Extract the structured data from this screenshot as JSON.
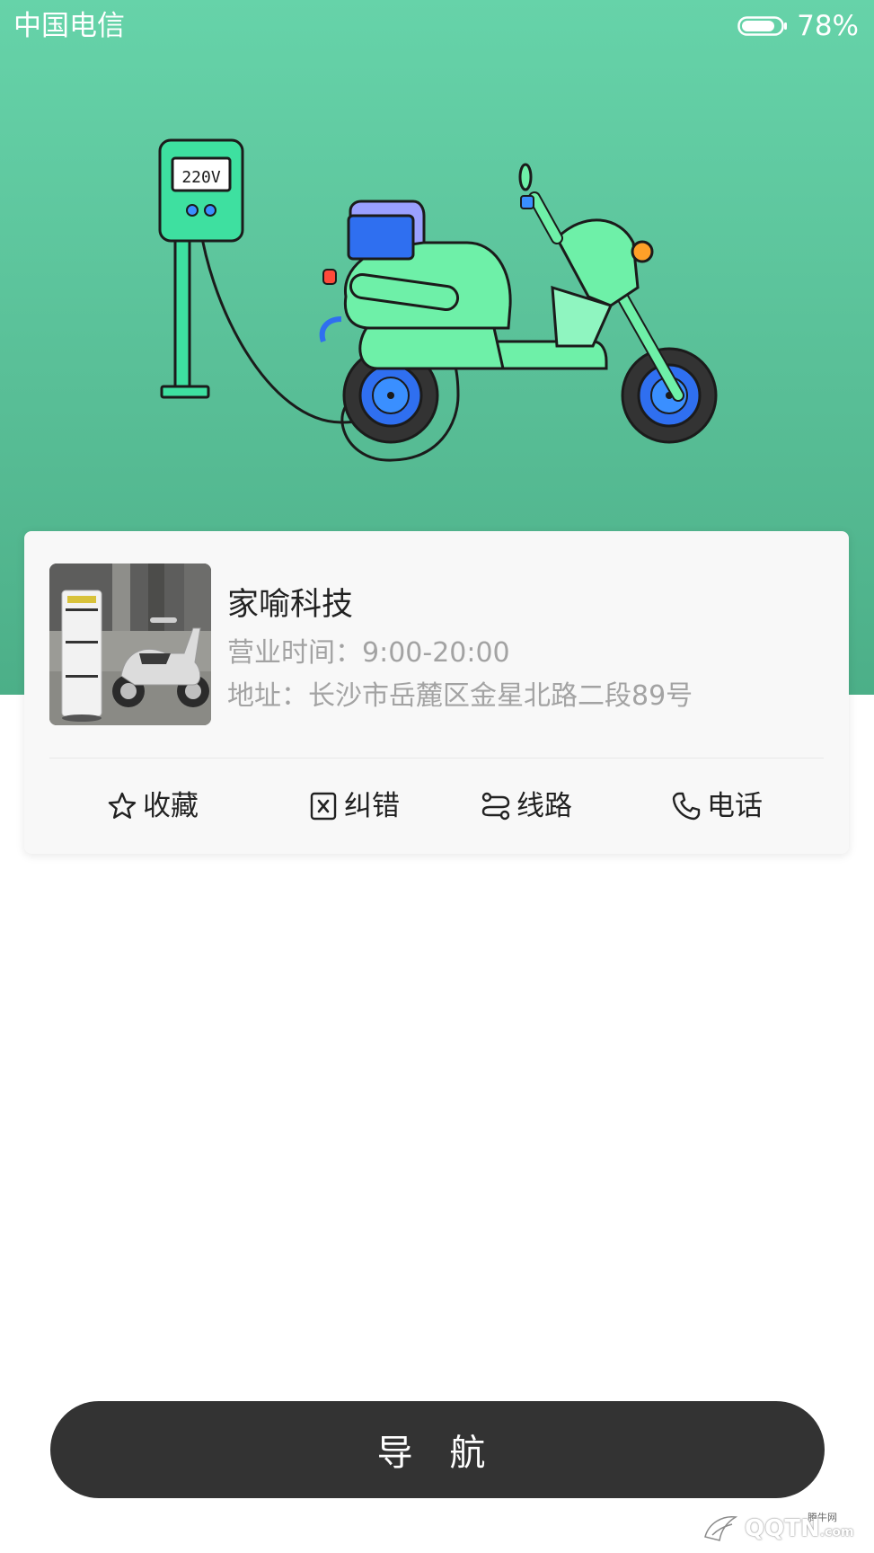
{
  "status_bar": {
    "carrier": "中国电信",
    "battery": "78%",
    "battery_level": 0.78
  },
  "illustration": {
    "charger_display": "220V"
  },
  "shop": {
    "name": "家喻科技",
    "hours_label": "营业时间：",
    "hours_value": "9:00-20:00",
    "address_label": "地址：",
    "address_value": "长沙市岳麓区金星北路二段89号"
  },
  "actions": [
    {
      "label": "收藏",
      "icon": "star-icon"
    },
    {
      "label": "纠错",
      "icon": "error-report-icon"
    },
    {
      "label": "线路",
      "icon": "route-icon"
    },
    {
      "label": "电话",
      "icon": "phone-icon"
    }
  ],
  "navigate_button": "导 航",
  "watermark": {
    "text": "QQTN",
    "small": "腾牛网",
    "domain": ".com"
  },
  "colors": {
    "hero_top": "#66d3a9",
    "hero_bottom": "#4caf88",
    "button_bg": "#333333",
    "secondary_text": "#a3a3a3"
  }
}
